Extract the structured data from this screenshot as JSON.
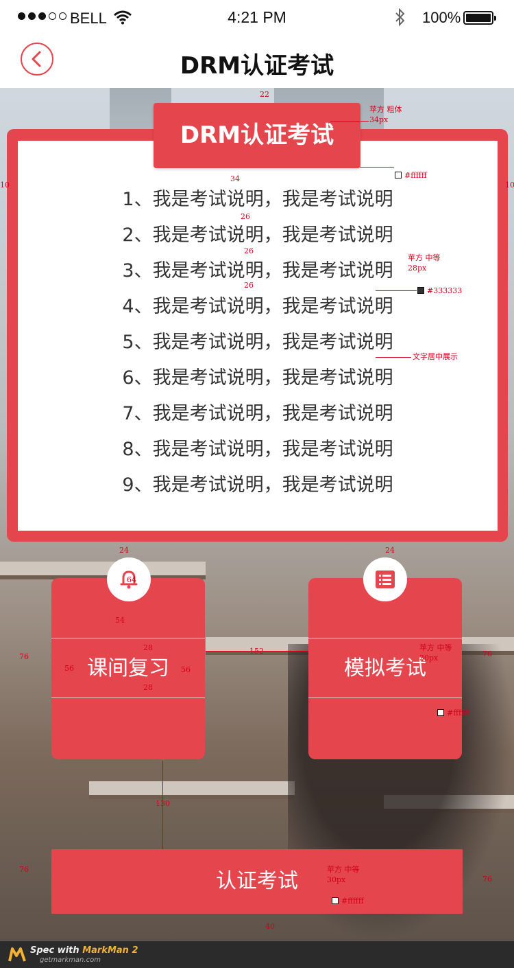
{
  "status_bar": {
    "carrier": "BELL",
    "time": "4:21 PM",
    "battery": "100%"
  },
  "nav": {
    "title": "DRM认证考试"
  },
  "card": {
    "title": "DRM认证考试",
    "rules": [
      "1、我是考试说明，我是考试说明",
      "2、我是考试说明，我是考试说明",
      "3、我是考试说明，我是考试说明",
      "4、我是考试说明，我是考试说明",
      "5、我是考试说明，我是考试说明",
      "6、我是考试说明，我是考试说明",
      "7、我是考试说明，我是考试说明",
      "8、我是考试说明，我是考试说明",
      "9、我是考试说明，我是考试说明"
    ]
  },
  "tiles": {
    "review": {
      "label": "课间复习"
    },
    "mock": {
      "label": "模拟考试"
    }
  },
  "cert": {
    "label": "认证考试"
  },
  "footer": {
    "brand_prefix": "Spec with ",
    "brand_name": "MarkMan 2",
    "url": "getmarkman.com"
  },
  "annotations": {
    "title_font": "苹方  粗体",
    "title_size": "34px",
    "title_color": "#ffffff",
    "rule_font": "苹方  中等",
    "rule_size": "28px",
    "rule_color": "#333333",
    "rule_note": "文字居中展示",
    "tile_font": "苹方  中等",
    "tile_size": "30px",
    "tile_color": "#ffffff",
    "cert_font": "苹方  中等",
    "cert_size": "30px",
    "cert_color": "#ffffff",
    "d_top": "22",
    "d_side_l": "10",
    "d_side_r": "10",
    "d_title_gap": "34",
    "d_line_gap1": "26",
    "d_line_gap2": "26",
    "d_line_gap3": "26",
    "d_card_gap_l": "24",
    "d_card_gap_r": "24",
    "d_icon": "64",
    "d_icon_gap": "54",
    "d_mid_top": "28",
    "d_mid_bottom": "28",
    "d_pad_l": "56",
    "d_pad_r": "56",
    "d_tiles_gap": "152",
    "d_margin_l": "76",
    "d_margin_r": "76",
    "d_cert_gap": "130",
    "d_cert_margin_l": "76",
    "d_cert_margin_r": "76",
    "d_bottom": "40"
  },
  "colors": {
    "accent": "#e5454c",
    "text": "#333333"
  }
}
